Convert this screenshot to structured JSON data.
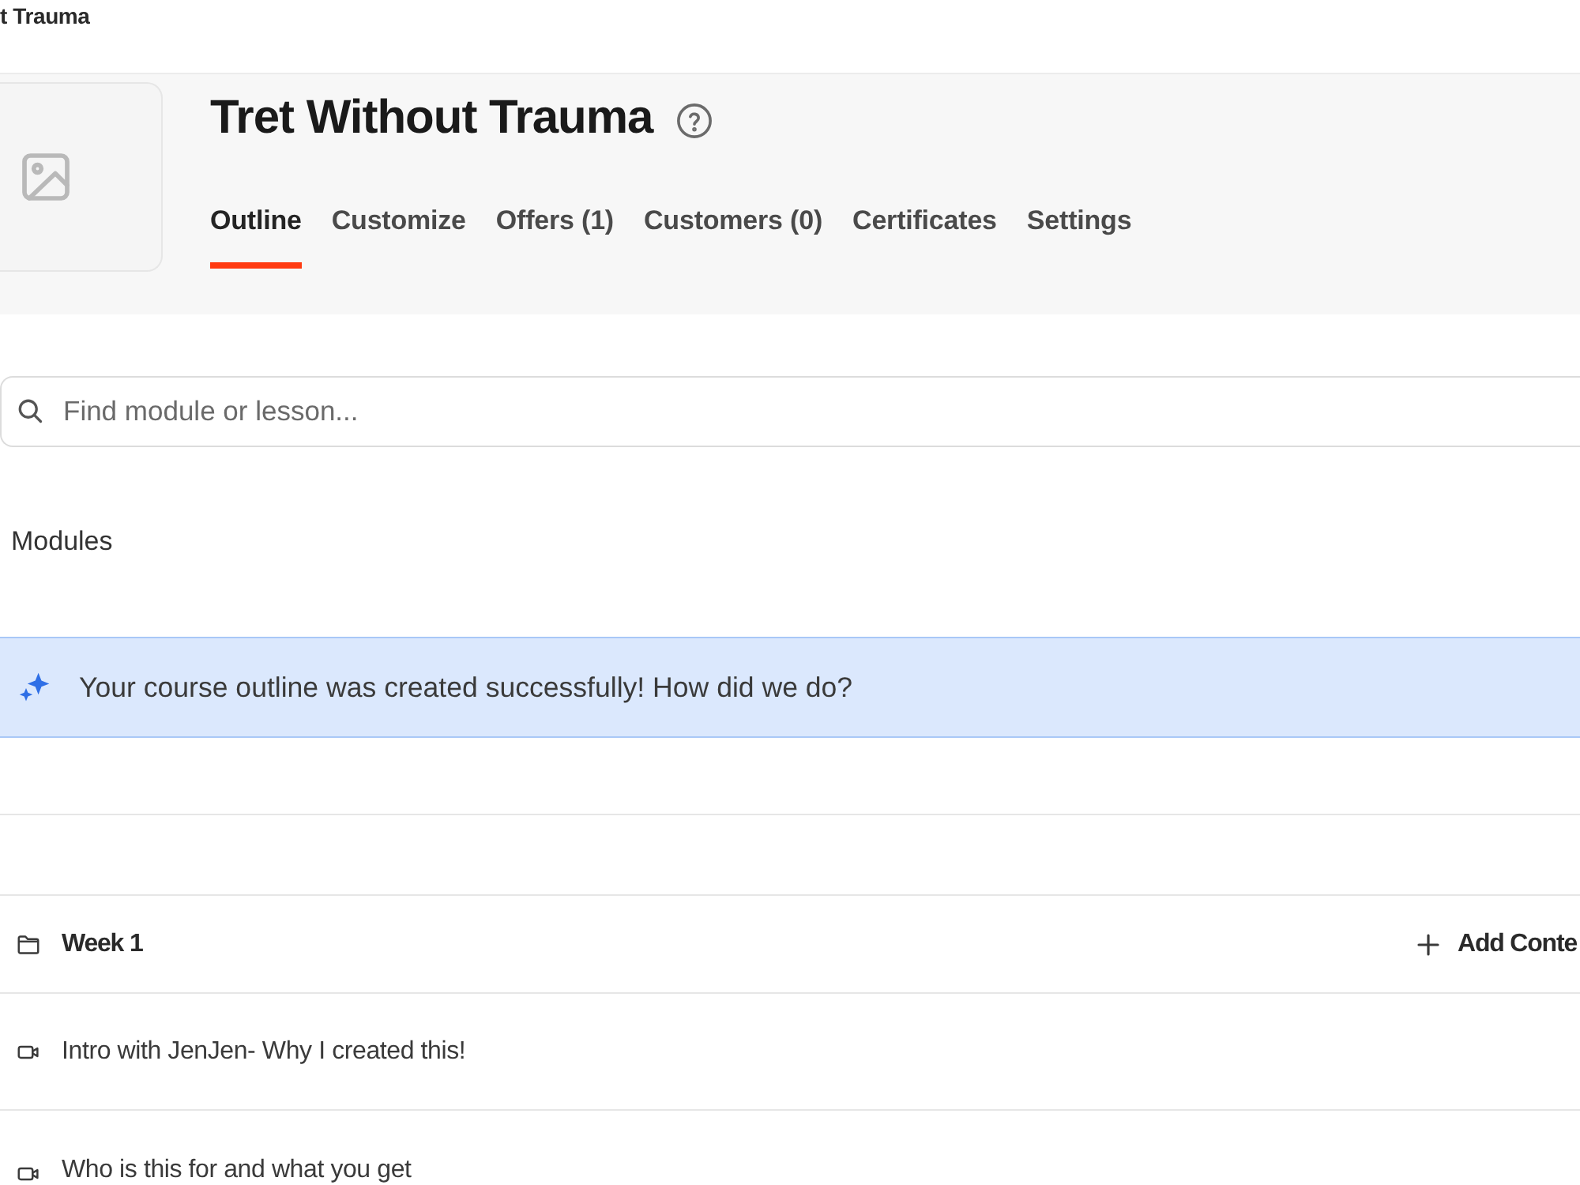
{
  "breadcrumb": "t Trauma",
  "course": {
    "title": "Tret Without Trauma"
  },
  "tabs": [
    {
      "label": "Outline",
      "selected": true
    },
    {
      "label": "Customize",
      "selected": false
    },
    {
      "label": "Offers (1)",
      "selected": false
    },
    {
      "label": "Customers (0)",
      "selected": false
    },
    {
      "label": "Certificates",
      "selected": false
    },
    {
      "label": "Settings",
      "selected": false
    }
  ],
  "search": {
    "placeholder": "Find module or lesson..."
  },
  "modules_count": "Modules",
  "banner": {
    "message": "Your course outline was created successfully! How did we do?"
  },
  "modules": [
    {
      "title": "Week 1",
      "action": "Add Conte",
      "lessons": [
        {
          "title": "Intro with JenJen- Why I created this!"
        },
        {
          "title": "Who is this for and what you get"
        }
      ]
    }
  ]
}
